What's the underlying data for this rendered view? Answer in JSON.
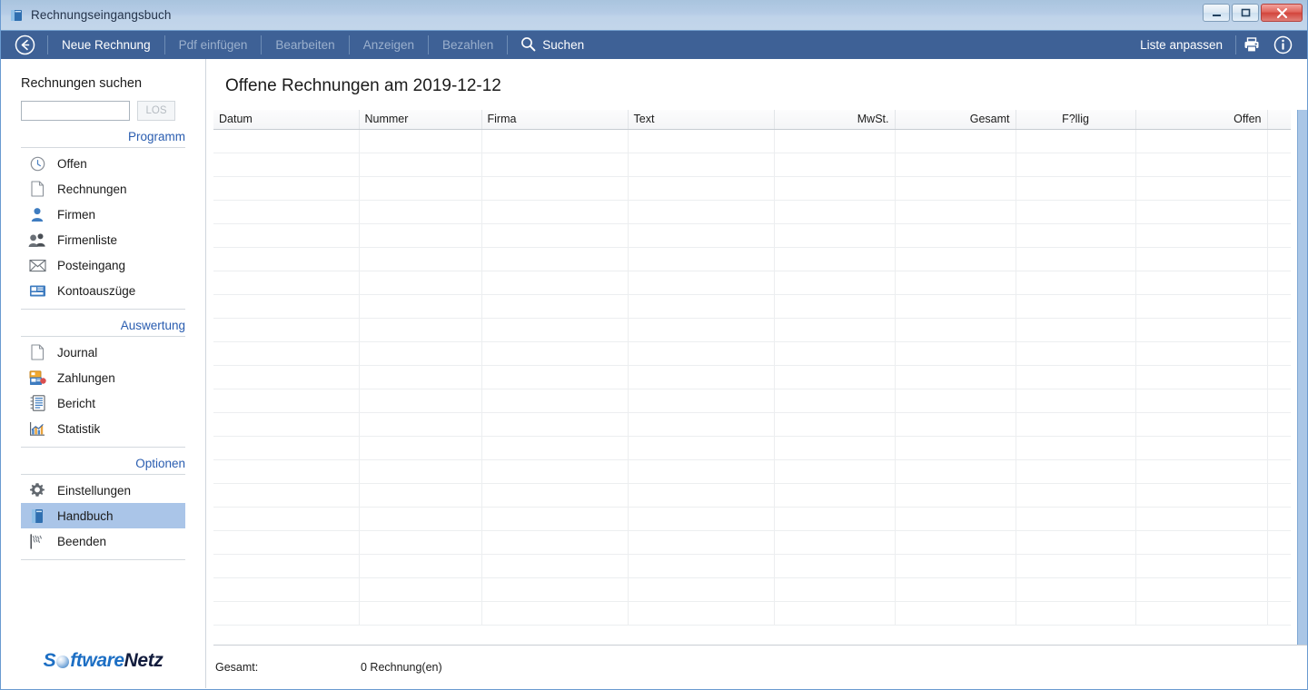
{
  "window": {
    "title": "Rechnungseingangsbuch",
    "icon": "book-icon",
    "controls": {
      "minimize": "minimize-button",
      "maximize": "maximize-button",
      "close": "close-button"
    }
  },
  "toolbar": {
    "back": "back-arrow-icon",
    "items": [
      {
        "label": "Neue Rechnung",
        "state": "active"
      },
      {
        "label": "Pdf einfügen",
        "state": "disabled"
      },
      {
        "label": "Bearbeiten",
        "state": "disabled"
      },
      {
        "label": "Anzeigen",
        "state": "disabled"
      },
      {
        "label": "Bezahlen",
        "state": "disabled"
      }
    ],
    "search": {
      "label": "Suchen",
      "icon": "magnifier-icon"
    },
    "right": {
      "customize_label": "Liste anpassen",
      "print_icon": "printer-icon",
      "info_icon": "info-icon"
    },
    "background": "#3e6196"
  },
  "sidebar": {
    "search": {
      "label": "Rechnungen suchen",
      "value": "",
      "placeholder": "",
      "button_label": "LOS"
    },
    "groups": [
      {
        "title": "Programm",
        "items": [
          {
            "label": "Offen",
            "icon": "clock-icon",
            "selected": false
          },
          {
            "label": "Rechnungen",
            "icon": "document-icon",
            "selected": false
          },
          {
            "label": "Firmen",
            "icon": "person-icon",
            "selected": false
          },
          {
            "label": "Firmenliste",
            "icon": "people-icon",
            "selected": false
          },
          {
            "label": "Posteingang",
            "icon": "envelope-icon",
            "selected": false
          },
          {
            "label": "Kontoauszüge",
            "icon": "bank-statement-icon",
            "selected": false
          }
        ]
      },
      {
        "title": "Auswertung",
        "items": [
          {
            "label": "Journal",
            "icon": "document-icon",
            "selected": false
          },
          {
            "label": "Zahlungen",
            "icon": "payments-icon",
            "selected": false
          },
          {
            "label": "Bericht",
            "icon": "report-icon",
            "selected": false
          },
          {
            "label": "Statistik",
            "icon": "chart-icon",
            "selected": false
          }
        ]
      },
      {
        "title": "Optionen",
        "items": [
          {
            "label": "Einstellungen",
            "icon": "gear-icon",
            "selected": false
          },
          {
            "label": "Handbuch",
            "icon": "book-icon",
            "selected": true
          },
          {
            "label": "Beenden",
            "icon": "exit-flag-icon",
            "selected": false
          }
        ]
      }
    ],
    "logo": {
      "part1": "S",
      "part2": "ftware",
      "part3": "Netz",
      "colors": {
        "blue": "#1d6fc4",
        "navy": "#121c3d"
      }
    },
    "accent_color": "#2a5db0",
    "selection_color": "#aac5e8"
  },
  "main": {
    "page_title": "Offene Rechnungen am 2019-12-12",
    "table": {
      "columns": [
        {
          "label": "Datum",
          "align": "left",
          "width": 160
        },
        {
          "label": "Nummer",
          "align": "left",
          "width": 135
        },
        {
          "label": "Firma",
          "align": "left",
          "width": 161
        },
        {
          "label": "Text",
          "align": "left",
          "width": 161
        },
        {
          "label": "MwSt.",
          "align": "right",
          "width": 133
        },
        {
          "label": "Gesamt",
          "align": "right",
          "width": 133
        },
        {
          "label": "F?llig",
          "align": "center",
          "width": 132
        },
        {
          "label": "Offen",
          "align": "right",
          "width": 145
        },
        {
          "label": "",
          "align": "left",
          "width": 26
        }
      ],
      "rows": [],
      "empty_row_count": 21
    },
    "status": {
      "label": "Gesamt:",
      "value": "0 Rechnung(en)"
    },
    "scrollbar": {
      "name": "vertical-scrollbar",
      "color": "#aac6e6"
    }
  }
}
